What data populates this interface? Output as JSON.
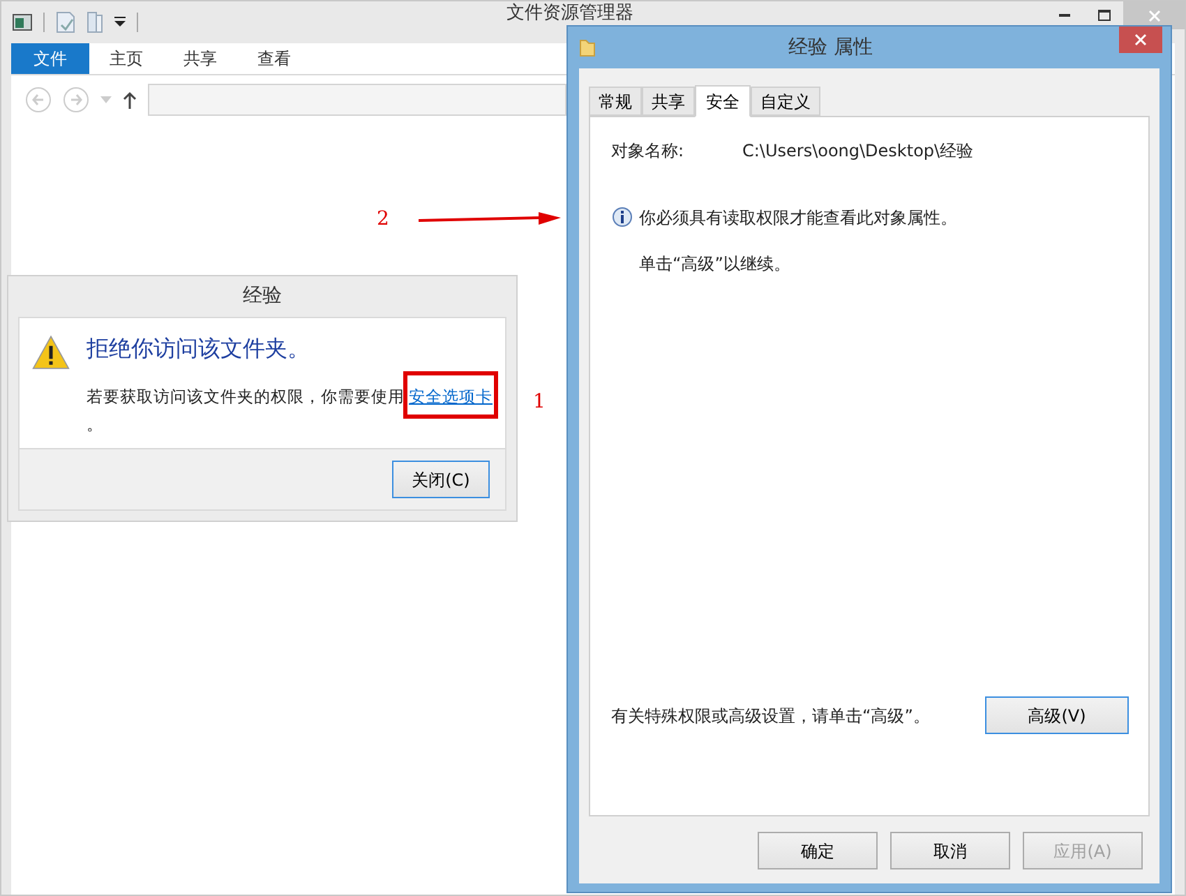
{
  "explorer": {
    "title": "文件资源管理器",
    "ribbon_tabs": [
      {
        "label": "文件",
        "selected": true
      },
      {
        "label": "主页",
        "selected": false
      },
      {
        "label": "共享",
        "selected": false
      },
      {
        "label": "查看",
        "selected": false
      }
    ]
  },
  "error_dialog": {
    "title": "经验",
    "heading": "拒绝你访问该文件夹。",
    "message": "若要获取访问该文件夹的权限，你需要使用",
    "link": "安全选项卡",
    "message_end": "。",
    "button": "关闭(C)"
  },
  "properties": {
    "title": "经验 属性",
    "tabs": [
      {
        "label": "常规",
        "selected": false
      },
      {
        "label": "共享",
        "selected": false
      },
      {
        "label": "安全",
        "selected": true
      },
      {
        "label": "自定义",
        "selected": false
      }
    ],
    "object_name_label": "对象名称:",
    "object_name": "C:\\Users\\oong\\Desktop\\经验",
    "notice": "你必须具有读取权限才能查看此对象属性。",
    "hint": "单击“高级”以继续。",
    "advanced_text": "有关特殊权限或高级设置，请单击“高级”。",
    "advanced_button": "高级(V)",
    "buttons": [
      {
        "label": "确定",
        "disabled": false
      },
      {
        "label": "取消",
        "disabled": false
      },
      {
        "label": "应用(A)",
        "disabled": true
      }
    ]
  },
  "annotations": {
    "step_1": "1",
    "step_2": "2"
  }
}
